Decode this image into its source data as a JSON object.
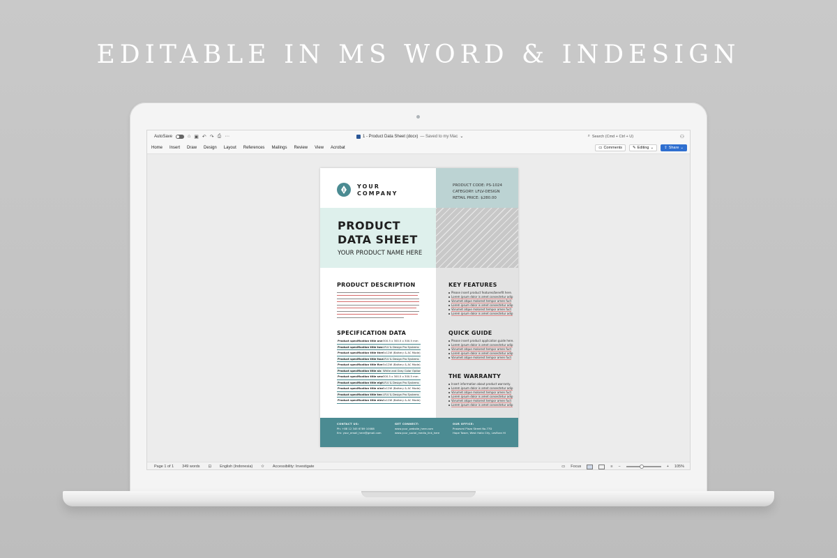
{
  "headline": "EDITABLE IN MS WORD & INDESIGN",
  "word": {
    "autosave_label": "AutoSave",
    "doc_name": "1 - Product Data Sheet (docx)",
    "saved_status": "— Saved to my Mac",
    "search_placeholder": "Search (Cmd + Ctrl + U)",
    "tabs": [
      "Home",
      "Insert",
      "Draw",
      "Design",
      "Layout",
      "References",
      "Mailings",
      "Review",
      "View",
      "Acrobat"
    ],
    "comments_label": "Comments",
    "editing_label": "Editing",
    "share_label": "Share",
    "status": {
      "page": "Page 1 of 1",
      "words": "349 words",
      "language": "English (Indonesia)",
      "accessibility": "Accessibility: Investigate",
      "focus": "Focus",
      "zoom": "105%",
      "zoom_fraction": 0.45
    }
  },
  "document": {
    "company": [
      "YOUR",
      "COMPANY"
    ],
    "meta": [
      "PRODUCT CODE:  PS-1024",
      "CATEGORY:  LFLV-DESIGN",
      "RETAIL PRICE:  $280.00"
    ],
    "title_lines": [
      "PRODUCT",
      "DATA SHEET"
    ],
    "subtitle": "YOUR PRODUCT NAME HERE",
    "sections": {
      "description": "PRODUCT DESCRIPTION",
      "specification": "SPECIFICATION DATA",
      "features": "KEY FEATURES",
      "guide": "QUICK GUIDE",
      "warranty": "THE WARRANTY"
    },
    "spec_rows": [
      {
        "k": "Product specification title one",
        "v": "300.5 x 300.5 x 300.5 mm"
      },
      {
        "k": "Product specification title two",
        "v": "LFLV & Design Pro Systems"
      },
      {
        "k": "Product specification title three",
        "v": "5x12W (Battery & AC Mode)"
      },
      {
        "k": "Product specification title four",
        "v": "LFLV & Design Pro Systems"
      },
      {
        "k": "Product specification title five",
        "v": "5x12W (Battery & AC Mode)"
      },
      {
        "k": "Product specification title six",
        "v": "White and Gray Color Option"
      },
      {
        "k": "Product specification title seven",
        "v": "300.5 x 300.5 x 300.5 mm"
      },
      {
        "k": "Product specification title eight",
        "v": "LFLV & Design Pro Systems"
      },
      {
        "k": "Product specification title nine",
        "v": "5x12W (Battery & AC Mode)"
      },
      {
        "k": "Product specification title ten",
        "v": "LFLV & Design Pro Systems"
      },
      {
        "k": "Product specification title eleven",
        "v": "5x12W (Battery & AC Mode)"
      }
    ],
    "features": [
      "Please insert product features/benefit here.",
      "Lorem ipsum dolor is amet consectetur adip",
      "Vorumet atque molorest tempor amen fuct",
      "Lorem ipsum dolor is amet consectetur adip",
      "Vorumet atque molorest tempor amen fuct",
      "Lorem ipsum dolor is amet consectetur adip"
    ],
    "guide": [
      "Please insert product application guide here.",
      "Lorem ipsum dolor is amet consectetur adip",
      "Vorumet atque molorest tempor amen fuct",
      "Lorem ipsum dolor is amet consectetur adip",
      "Vorumet atque molorest tempor amen fuct"
    ],
    "warranty": [
      "Insert information about product warranty.",
      "Lorem ipsum dolor is amet consectetur adip",
      "Vorumet atque molorest tempor amen fuct",
      "Lorem ipsum dolor is amet consectetur adip",
      "Vorumet atque molorest tempor amen fuct",
      "Lorem ipsum dolor is amet consectetur adip"
    ],
    "footer": {
      "contact_label": "CONTACT US:",
      "contact": [
        "Ph: +88 12 345 6789 10088",
        "Em: your_email_here@gmail.com"
      ],
      "connect_label": "GET CONNECT:",
      "connect": [
        "www.your_website_here.com",
        "www.your_social_media_link_here"
      ],
      "office_label": "OUR OFFICE:",
      "office": [
        "Prosesmi Plaza Street No.77D",
        "Hope Tower, West Halla City, Lesflora HI"
      ]
    }
  }
}
